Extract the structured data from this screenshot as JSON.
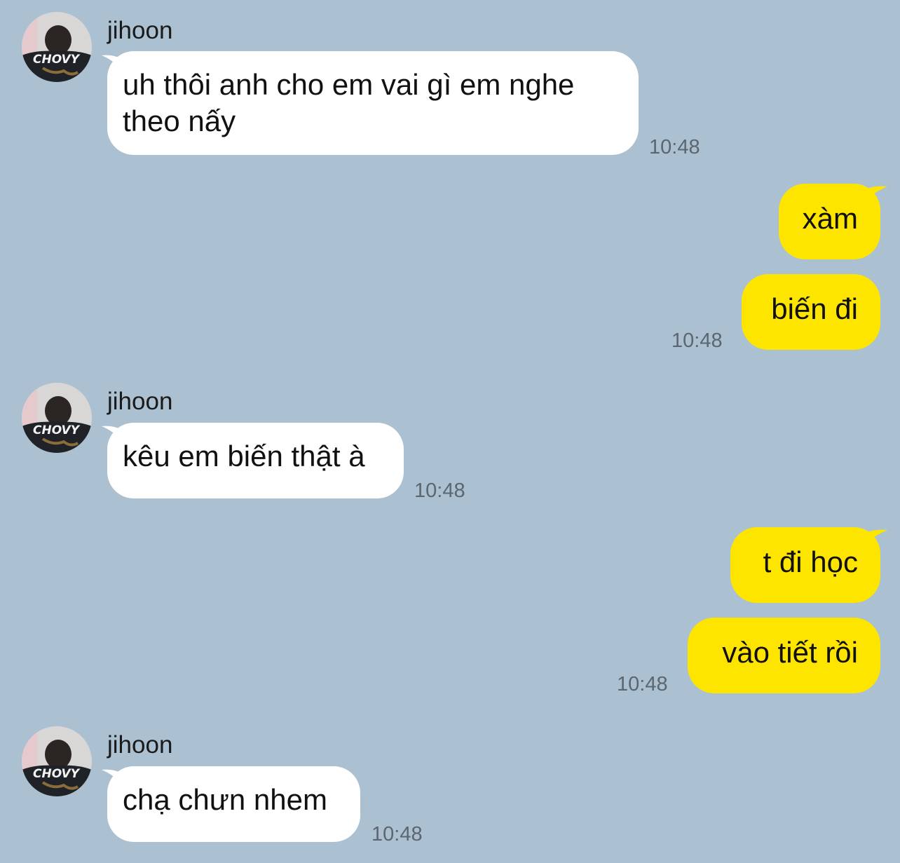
{
  "colors": {
    "background": "#abc1d1",
    "incoming_bubble": "#ffffff",
    "outgoing_bubble": "#fee500",
    "time_text": "#5c6670"
  },
  "messages": [
    {
      "sender": "jihoon",
      "avatar_icon": "profile-avatar",
      "text_lines": [
        "uh thôi anh cho em vai gì em nghe",
        "theo nấy"
      ],
      "time": "10:48"
    },
    {
      "outgoing": [
        "xàm",
        "biến đi"
      ],
      "time": "10:48"
    },
    {
      "sender": "jihoon",
      "avatar_icon": "profile-avatar",
      "text": "kêu em biến thật à",
      "time": "10:48"
    },
    {
      "outgoing": [
        "t đi học",
        "vào tiết rồi"
      ],
      "time": "10:48"
    },
    {
      "sender": "jihoon",
      "avatar_icon": "profile-avatar",
      "text": "chạ chưn nhem",
      "time": "10:48"
    }
  ]
}
